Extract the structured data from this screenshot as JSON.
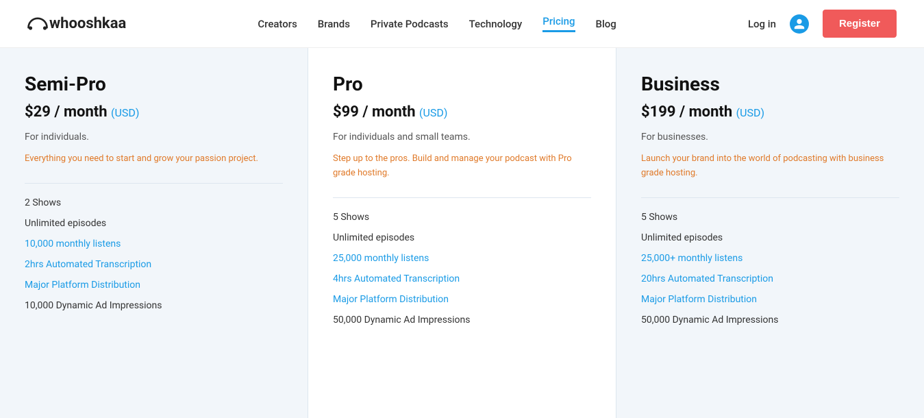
{
  "header": {
    "logo_text": "whooshkaa",
    "nav_items": [
      {
        "label": "Creators",
        "active": false
      },
      {
        "label": "Brands",
        "active": false
      },
      {
        "label": "Private Podcasts",
        "active": false
      },
      {
        "label": "Technology",
        "active": false
      },
      {
        "label": "Pricing",
        "active": true
      },
      {
        "label": "Blog",
        "active": false
      }
    ],
    "login_label": "Log in",
    "register_label": "Register"
  },
  "plans": [
    {
      "name": "Semi-Pro",
      "price": "$29",
      "period": "/ month",
      "currency": "(USD)",
      "audience": "For individuals.",
      "description": "Everything you need to start and grow your passion project.",
      "features": [
        {
          "text": "2 Shows",
          "highlight": false
        },
        {
          "text": "Unlimited episodes",
          "highlight": false
        },
        {
          "text": "10,000 monthly listens",
          "highlight": true
        },
        {
          "text": "2hrs Automated Transcription",
          "highlight": true
        },
        {
          "text": "Major Platform Distribution",
          "highlight": true
        },
        {
          "text": "10,000 Dynamic Ad Impressions",
          "highlight": false
        }
      ]
    },
    {
      "name": "Pro",
      "price": "$99",
      "period": "/ month",
      "currency": "(USD)",
      "audience": "For individuals and small teams.",
      "description": "Step up to the pros. Build and manage your podcast with Pro grade hosting.",
      "features": [
        {
          "text": "5 Shows",
          "highlight": false
        },
        {
          "text": "Unlimited episodes",
          "highlight": false
        },
        {
          "text": "25,000 monthly listens",
          "highlight": true
        },
        {
          "text": "4hrs Automated Transcription",
          "highlight": true
        },
        {
          "text": "Major Platform Distribution",
          "highlight": true
        },
        {
          "text": "50,000 Dynamic Ad Impressions",
          "highlight": false
        }
      ]
    },
    {
      "name": "Business",
      "price": "$199",
      "period": "/ month",
      "currency": "(USD)",
      "audience": "For businesses.",
      "description": "Launch your brand into the world of podcasting with business grade hosting.",
      "features": [
        {
          "text": "5 Shows",
          "highlight": false
        },
        {
          "text": "Unlimited episodes",
          "highlight": false
        },
        {
          "text": "25,000+ monthly listens",
          "highlight": true
        },
        {
          "text": "20hrs Automated Transcription",
          "highlight": true
        },
        {
          "text": "Major Platform Distribution",
          "highlight": true
        },
        {
          "text": "50,000 Dynamic Ad Impressions",
          "highlight": false
        }
      ]
    }
  ]
}
